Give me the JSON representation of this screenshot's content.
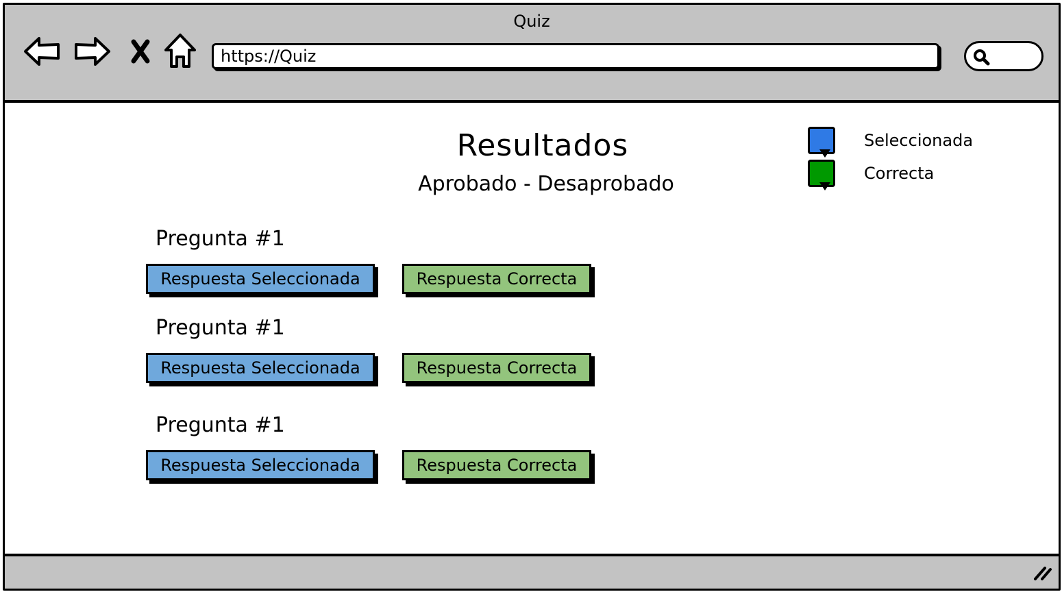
{
  "window": {
    "title": "Quiz"
  },
  "toolbar": {
    "back_icon": "back-arrow-icon",
    "forward_icon": "forward-arrow-icon",
    "stop_icon": "close-icon",
    "home_icon": "home-icon",
    "address": "https://Quiz",
    "search_icon": "search-icon"
  },
  "page": {
    "title": "Resultados",
    "subtitle": "Aprobado - Desaprobado"
  },
  "legend": [
    {
      "label": "Seleccionada",
      "color": "#2f7ae5"
    },
    {
      "label": "Correcta",
      "color": "#009900"
    }
  ],
  "colors": {
    "selected_answer": "#6fa8dc",
    "correct_answer": "#93c47d",
    "chrome": "#c3c3c3"
  },
  "questions": [
    {
      "label": "Pregunta #1",
      "selected": "Respuesta Seleccionada",
      "correct": "Respuesta Correcta"
    },
    {
      "label": "Pregunta #1",
      "selected": "Respuesta Seleccionada",
      "correct": "Respuesta Correcta"
    },
    {
      "label": "Pregunta #1",
      "selected": "Respuesta Seleccionada",
      "correct": "Respuesta Correcta"
    }
  ]
}
